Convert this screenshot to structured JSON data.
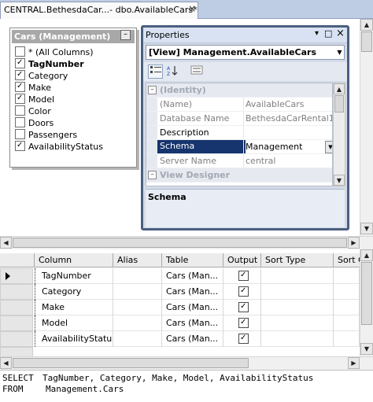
{
  "tab": {
    "title": "CENTRAL.BethesdaCar...- dbo.AvailableCars*",
    "close": "×"
  },
  "table_box": {
    "title": "Cars (Management)",
    "minimize": "–",
    "columns": [
      {
        "label": "* (All Columns)",
        "checked": false,
        "bold": false
      },
      {
        "label": "TagNumber",
        "checked": true,
        "bold": true
      },
      {
        "label": "Category",
        "checked": true,
        "bold": false
      },
      {
        "label": "Make",
        "checked": true,
        "bold": false
      },
      {
        "label": "Model",
        "checked": true,
        "bold": false
      },
      {
        "label": "Color",
        "checked": false,
        "bold": false
      },
      {
        "label": "Doors",
        "checked": false,
        "bold": false
      },
      {
        "label": "Passengers",
        "checked": false,
        "bold": false
      },
      {
        "label": "AvailabilityStatus",
        "checked": true,
        "bold": false
      }
    ]
  },
  "properties": {
    "title": "Properties",
    "pin": "▾",
    "float": "□",
    "close": "×",
    "object": "[View] Management.AvailableCars",
    "rows": [
      {
        "kind": "cat",
        "name": "(Identity)",
        "value": "",
        "exp": "–"
      },
      {
        "kind": "ro",
        "name": "(Name)",
        "value": "AvailableCars"
      },
      {
        "kind": "ro",
        "name": "Database Name",
        "value": "BethesdaCarRental1"
      },
      {
        "kind": "norm",
        "name": "Description",
        "value": ""
      },
      {
        "kind": "sel",
        "name": "Schema",
        "value": "Management"
      },
      {
        "kind": "ro",
        "name": "Server Name",
        "value": "central"
      },
      {
        "kind": "cat",
        "name": "View Designer",
        "value": "",
        "exp": "–"
      }
    ],
    "description_title": "Schema"
  },
  "grid": {
    "headers": [
      "Column",
      "Alias",
      "Table",
      "Output",
      "Sort Type",
      "Sort O"
    ],
    "rows": [
      {
        "column": "TagNumber",
        "alias": "",
        "table": "Cars (Man...",
        "output": true,
        "current": true
      },
      {
        "column": "Category",
        "alias": "",
        "table": "Cars (Man...",
        "output": true,
        "current": false
      },
      {
        "column": "Make",
        "alias": "",
        "table": "Cars (Man...",
        "output": true,
        "current": false
      },
      {
        "column": "Model",
        "alias": "",
        "table": "Cars (Man...",
        "output": true,
        "current": false
      },
      {
        "column": "AvailabilityStatus",
        "alias": "",
        "table": "Cars (Man...",
        "output": true,
        "current": false
      }
    ]
  },
  "sql": {
    "select_kw": "SELECT",
    "select_body": "TagNumber, Category, Make, Model, AvailabilityStatus",
    "from_kw": "FROM",
    "from_body": "Management.Cars"
  },
  "scroll_arrows": {
    "up": "▲",
    "down": "▼",
    "left": "◀",
    "right": "▶"
  }
}
